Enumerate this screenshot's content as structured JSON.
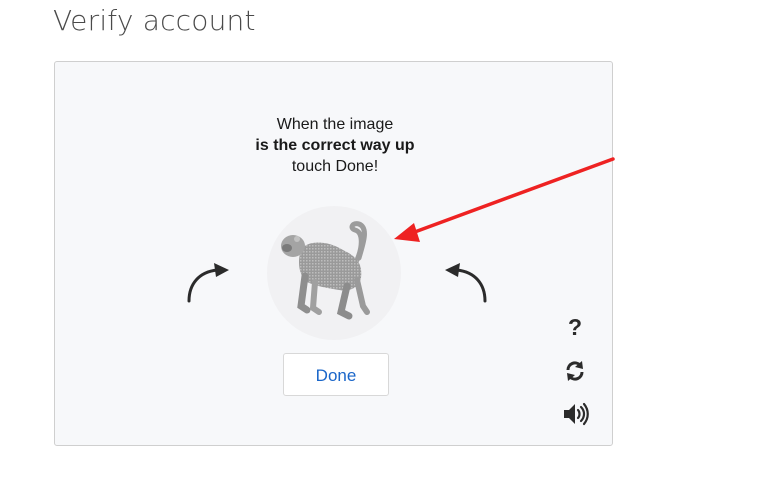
{
  "page": {
    "title": "Verify account"
  },
  "captcha": {
    "instruction_line1": "When the image",
    "instruction_line2": "is the correct way up",
    "instruction_line3": "touch Done!",
    "done_label": "Done",
    "help_label": "?",
    "image_subject": "rotated-monkey-image",
    "rotate_left_icon": "rotate-left-arrow-icon",
    "rotate_right_icon": "rotate-right-arrow-icon",
    "refresh_icon": "refresh-icon",
    "audio_icon": "speaker-icon"
  },
  "annotation": {
    "arrow_color": "#ee2222"
  },
  "colors": {
    "card_background": "#f7f8fa",
    "done_text": "#1a66c9",
    "icon": "#2b2b2b"
  }
}
